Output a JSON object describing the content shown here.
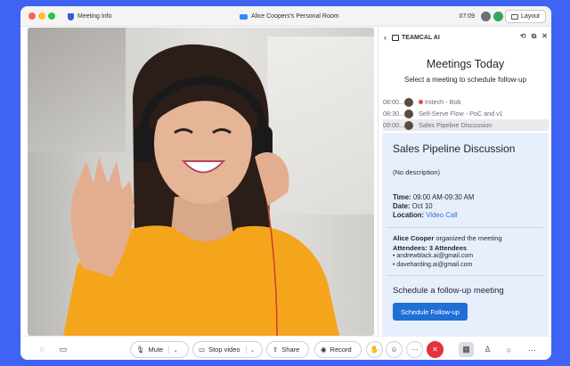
{
  "titlebar": {
    "meeting_info": "Meeting Info",
    "room_title": "Alice Coopers's Personal Room",
    "time": "07:09",
    "layout_label": "Layout"
  },
  "panel": {
    "app_name": "TEAMCAL AI",
    "title": "Meetings Today",
    "subtitle": "Select a meeting to schedule follow-up",
    "meetings": [
      {
        "time": "08:00...",
        "name": "Initech - Bob",
        "has_dot": true
      },
      {
        "time": "08:30...",
        "name": "Self-Serve Flow - PoC and v1",
        "has_dot": false
      },
      {
        "time": "09:00...",
        "name": "Sales Pipeline Discussion",
        "has_dot": false
      }
    ],
    "details": {
      "title": "Sales Pipeline Discussion",
      "description": "(No description)",
      "time_label": "Time:",
      "time_value": "09:00 AM-09:30 AM",
      "date_label": "Date:",
      "date_value": "Oct 10",
      "location_label": "Location:",
      "location_value": "Video Call",
      "organizer_name": "Alice Cooper",
      "organizer_suffix": "organized the meeting",
      "attendees_label": "Attendees: 3 Attendees",
      "attendees": [
        "andrewblack.ai@gmail.com",
        "daveharding.ai@gmail.com"
      ],
      "followup_heading": "Schedule a follow-up meeting",
      "followup_button": "Schedule Follow-up"
    }
  },
  "toolbar": {
    "mute": "Mute",
    "stop_video": "Stop video",
    "share": "Share",
    "record": "Record"
  },
  "colors": {
    "background": "#3f63f2",
    "accent": "#1f6fd6",
    "end_call": "#e5323b",
    "details_bg": "#e8effc"
  }
}
